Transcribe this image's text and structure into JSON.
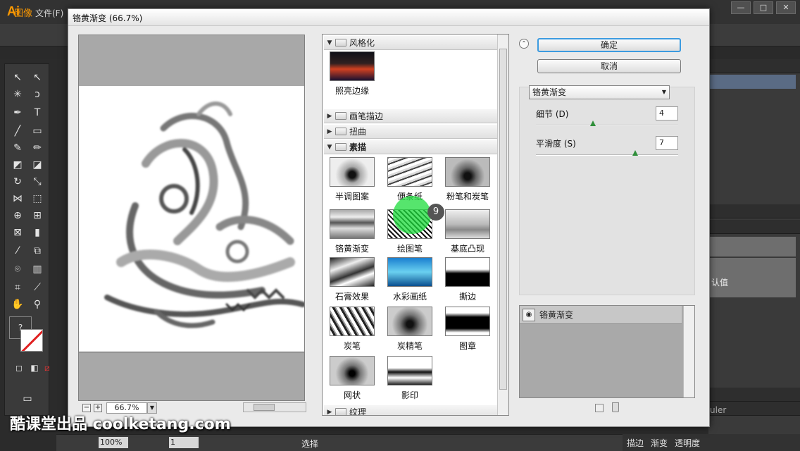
{
  "app": {
    "logo": "Ai",
    "menu_file": "文件(F)",
    "control_label": "图像",
    "window_min": "—",
    "window_max": "□",
    "window_close": "✕"
  },
  "dialog": {
    "title": "铬黄渐变 (66.7%)",
    "ok_label": "确定",
    "cancel_label": "取消",
    "zoom_minus": "−",
    "zoom_plus": "+",
    "zoom_value": "66.7%"
  },
  "gallery": {
    "categories": [
      {
        "label": "风格化",
        "expanded": true
      },
      {
        "label": "画笔描边",
        "expanded": false
      },
      {
        "label": "扭曲",
        "expanded": false
      },
      {
        "label": "素描",
        "expanded": true
      },
      {
        "label": "纹理",
        "expanded": false
      }
    ],
    "stylize_items": [
      "照亮边缘"
    ],
    "sketch_items": [
      "半调图案",
      "便条纸",
      "粉笔和炭笔",
      "铬黄渐变",
      "绘图笔",
      "基底凸现",
      "石膏效果",
      "水彩画纸",
      "撕边",
      "炭笔",
      "炭精笔",
      "图章",
      "网状",
      "影印"
    ],
    "selected": "铬黄渐变"
  },
  "options": {
    "filter_select": "铬黄渐变",
    "detail_label": "细节 (D)",
    "detail_value": "4",
    "detail_level": 0.4,
    "smooth_label": "平滑度 (S)",
    "smooth_value": "7",
    "smooth_level": 0.7
  },
  "layers": {
    "active": "铬黄渐变"
  },
  "click_badge": "9",
  "status": {
    "zoom": "100%",
    "page": "1",
    "tool": "选择"
  },
  "bottom_tabs": [
    "描边",
    "渐变",
    "透明度"
  ],
  "panels": {
    "value_label": "认值",
    "ruler_label": "uler"
  },
  "watermark": "酷课堂出品 coolketang.com",
  "colors": {
    "accent_orange": "#ff9a00",
    "ok_focus": "#3c9be0",
    "cursor_halo": "#1edc3c"
  }
}
